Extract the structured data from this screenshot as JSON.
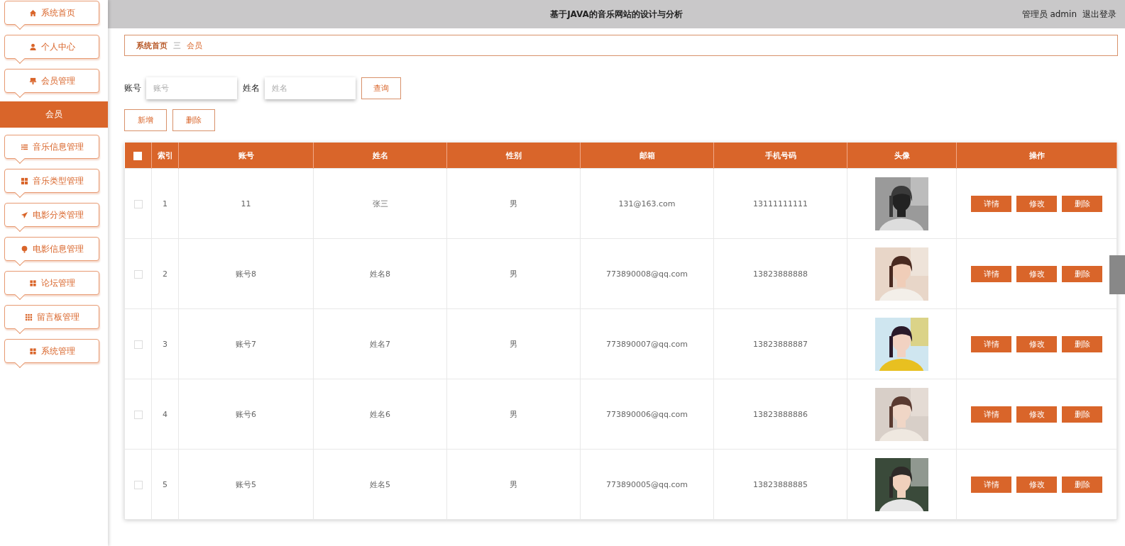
{
  "header": {
    "title": "基于JAVA的音乐网站的设计与分析",
    "user": "管理员 admin",
    "logout": "退出登录"
  },
  "sidebar": {
    "items": [
      {
        "label": "系统首页"
      },
      {
        "label": "个人中心"
      },
      {
        "label": "会员管理",
        "children": [
          {
            "label": "会员",
            "selected": true
          }
        ]
      },
      {
        "label": "音乐信息管理"
      },
      {
        "label": "音乐类型管理"
      },
      {
        "label": "电影分类管理"
      },
      {
        "label": "电影信息管理"
      },
      {
        "label": "论坛管理"
      },
      {
        "label": "留言板管理"
      },
      {
        "label": "系统管理"
      }
    ]
  },
  "breadcrumb": {
    "home": "系统首页",
    "separator": "三",
    "current": "会员"
  },
  "search": {
    "fields": [
      {
        "label": "账号",
        "placeholder": "账号"
      },
      {
        "label": "姓名",
        "placeholder": "姓名"
      }
    ],
    "button": "查询"
  },
  "actions": [
    "新增",
    "删除"
  ],
  "table": {
    "header_checked": false,
    "columns": [
      "索引",
      "账号",
      "姓名",
      "性别",
      "邮箱",
      "手机号码",
      "头像",
      "操作"
    ],
    "rows": [
      {
        "checked": false,
        "index": "1",
        "account": "11",
        "name": "张三",
        "gender": "男",
        "email": "131@163.com",
        "phone": "13111111111",
        "actions": [
          "详情",
          "修改",
          "删除"
        ]
      },
      {
        "checked": false,
        "index": "2",
        "account": "账号8",
        "name": "姓名8",
        "gender": "男",
        "email": "773890008@qq.com",
        "phone": "13823888888",
        "actions": [
          "详情",
          "修改",
          "删除"
        ]
      },
      {
        "checked": false,
        "index": "3",
        "account": "账号7",
        "name": "姓名7",
        "gender": "男",
        "email": "773890007@qq.com",
        "phone": "13823888887",
        "actions": [
          "详情",
          "修改",
          "删除"
        ]
      },
      {
        "checked": false,
        "index": "4",
        "account": "账号6",
        "name": "姓名6",
        "gender": "男",
        "email": "773890006@qq.com",
        "phone": "13823888886",
        "actions": [
          "详情",
          "修改",
          "删除"
        ]
      },
      {
        "checked": false,
        "index": "5",
        "account": "账号5",
        "name": "姓名5",
        "gender": "男",
        "email": "773890005@qq.com",
        "phone": "13823888885",
        "actions": [
          "详情",
          "修改",
          "删除"
        ]
      }
    ]
  }
}
